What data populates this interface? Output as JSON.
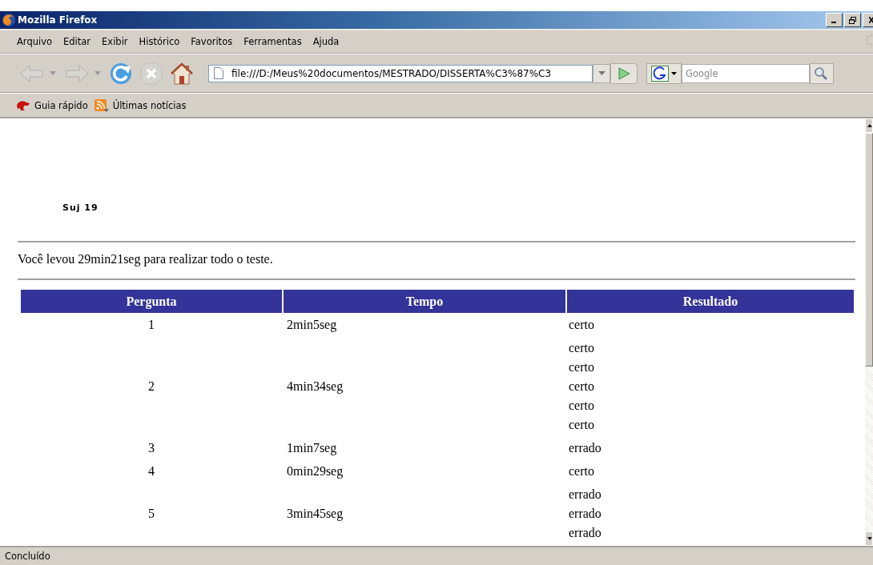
{
  "window": {
    "title": "Mozilla Firefox"
  },
  "menu": [
    {
      "label": "Arquivo"
    },
    {
      "label": "Editar"
    },
    {
      "label": "Exibir"
    },
    {
      "label": "Histórico"
    },
    {
      "label": "Favoritos"
    },
    {
      "label": "Ferramentas"
    },
    {
      "label": "Ajuda"
    }
  ],
  "toolbar": {
    "url": "file:///D:/Meus%20documentos/MESTRADO/DISSERTA%C3%87%C3",
    "search_placeholder": "Google",
    "back_disabled": true,
    "forward_disabled": true,
    "stop_disabled": true
  },
  "bookmarks": [
    {
      "label": "Guia rápido",
      "kind": "page"
    },
    {
      "label": "Últimas notícias",
      "kind": "feed"
    }
  ],
  "page": {
    "subject": "Suj 19",
    "summary": "Você levou 29min21seg para realizar todo o teste.",
    "table": {
      "columns": [
        "Pergunta",
        "Tempo",
        "Resultado"
      ],
      "rows": [
        {
          "pergunta": "1",
          "tempo": "2min5seg",
          "resultados": [
            "certo"
          ]
        },
        {
          "pergunta": "2",
          "tempo": "4min34seg",
          "resultados": [
            "certo",
            "certo",
            "certo",
            "certo",
            "certo"
          ]
        },
        {
          "pergunta": "3",
          "tempo": "1min7seg",
          "resultados": [
            "errado"
          ]
        },
        {
          "pergunta": "4",
          "tempo": "0min29seg",
          "resultados": [
            "certo"
          ]
        },
        {
          "pergunta": "5",
          "tempo": "3min45seg",
          "resultados": [
            "errado",
            "errado",
            "errado"
          ]
        }
      ]
    }
  },
  "status_bar": "Concluído"
}
